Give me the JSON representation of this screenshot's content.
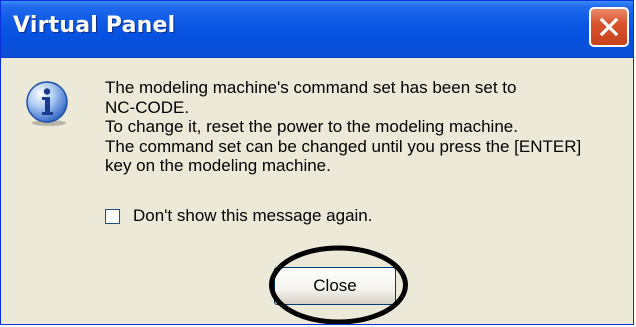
{
  "window": {
    "title": "Virtual Panel",
    "close_icon": "close-x-icon"
  },
  "dialog": {
    "icon": "information-icon",
    "message_lines": [
      "The modeling machine's command set has been set to",
      "NC-CODE.",
      "To change it, reset the power to the modeling machine.",
      "The command set can be changed until you press the [ENTER]",
      "key on the modeling machine."
    ],
    "checkbox": {
      "label": "Don't show this message again.",
      "checked": false
    },
    "button_label": "Close"
  },
  "colors": {
    "titlebar": "#0a56e3",
    "dialog_bg": "#ece9d8",
    "close_x": "#d9532e",
    "highlight_ring": "#000000"
  }
}
